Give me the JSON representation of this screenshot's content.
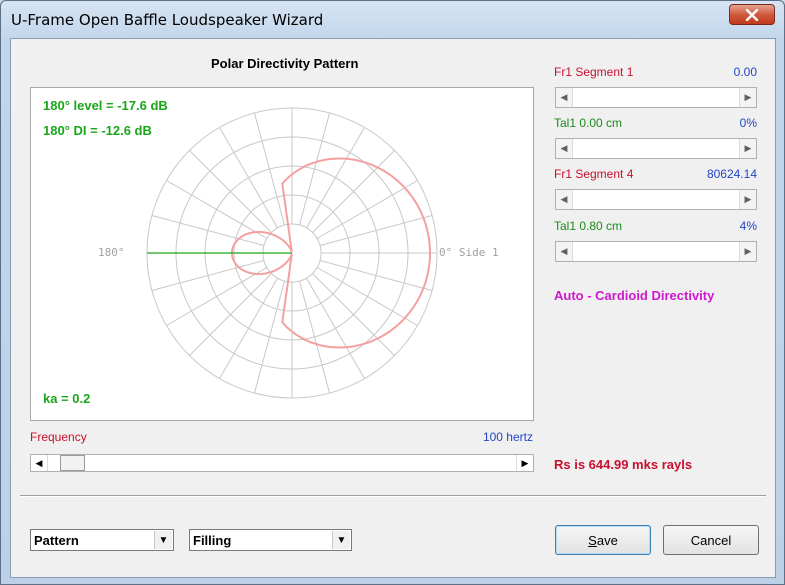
{
  "window": {
    "title": "U-Frame Open Baffle Loudspeaker Wizard"
  },
  "polar": {
    "title": "Polar Directivity Pattern",
    "level_180": "180° level = -17.6 dB",
    "di_180": "180° DI = -12.6 dB",
    "ka": "ka = 0.2",
    "label_left": "180°",
    "label_right": "0° Side 1",
    "pattern_color": "#f4a0a0",
    "grid_color": "#c8c8c8",
    "indicator_color": "#1aa61a"
  },
  "frequency": {
    "label": "Frequency",
    "value": "100 hertz",
    "slider_fraction": 0.03
  },
  "controls": [
    {
      "label": "Fr1  Segment 1",
      "value": "0.00",
      "label_color": "#c8102e",
      "value_color": "#2346c8",
      "slider_fraction": 0.0
    },
    {
      "label": "Tal1  0.00 cm",
      "value": "0%",
      "label_color": "#1a8a1a",
      "value_color": "#2346c8",
      "slider_fraction": 0.0
    },
    {
      "label": "Fr1  Segment 4",
      "value": "80624.14",
      "label_color": "#c8102e",
      "value_color": "#2346c8",
      "slider_fraction": 0.0
    },
    {
      "label": "Tal1  0.80 cm",
      "value": "4%",
      "label_color": "#1a8a1a",
      "value_color": "#2346c8",
      "slider_fraction": 0.0
    }
  ],
  "status": {
    "mode": "Auto - Cardioid Directivity",
    "rs": "Rs is 644.99 mks rayls"
  },
  "combos": {
    "pattern": "Pattern",
    "filling": "Filling"
  },
  "buttons": {
    "save_prefix": "S",
    "save_rest": "ave",
    "cancel": "Cancel"
  },
  "icons": {
    "close": "close-x-icon",
    "drop": "dropdown-arrow-icon",
    "left": "scroll-left-arrow-icon",
    "right": "scroll-right-arrow-icon"
  }
}
